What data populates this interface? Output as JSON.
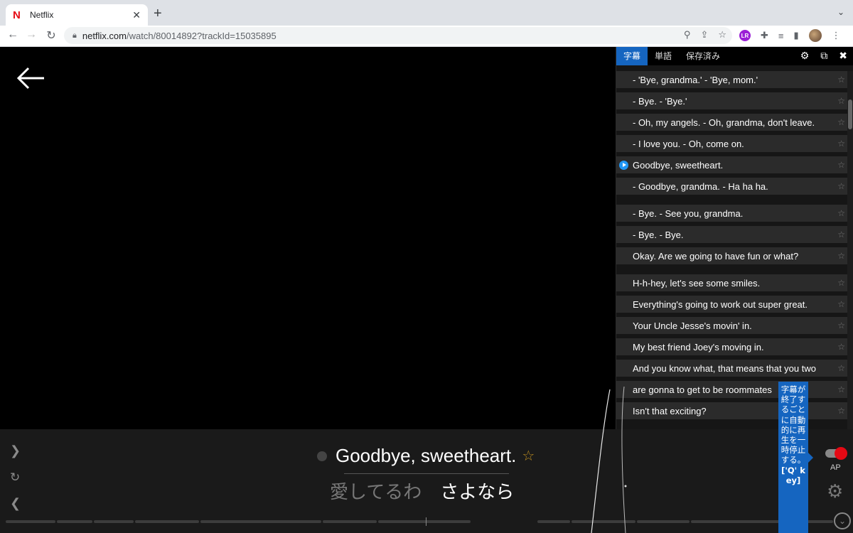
{
  "browser": {
    "tab_title": "Netflix",
    "tab_favicon": "N",
    "tab_close": "✕",
    "new_tab": "+",
    "url_host": "netflix.com",
    "url_path": "/watch/80014892?trackId=15035895",
    "extension_badge": "LR"
  },
  "panel": {
    "tabs": [
      "字幕",
      "単語",
      "保存済み"
    ],
    "active_tab": "字幕",
    "subtitles": [
      {
        "text": "- 'Bye, grandma.' - 'Bye, mom.'",
        "playing": false
      },
      {
        "text": "- Bye. - 'Bye.'",
        "playing": false
      },
      {
        "text": "- Oh, my angels. - Oh, grandma, don't leave.",
        "playing": false
      },
      {
        "text": "- I love you. - Oh, come on.",
        "playing": false
      },
      {
        "text": "Goodbye, sweetheart.",
        "playing": true
      },
      {
        "text": "- Goodbye, grandma. - Ha ha ha.",
        "playing": false
      },
      {
        "text": "- Bye. - See you, grandma.",
        "playing": false
      },
      {
        "text": "- Bye. - Bye.",
        "playing": false
      },
      {
        "text": "Okay. Are we going to have fun or what?",
        "playing": false
      },
      {
        "text": "H-h-hey, let's see some smiles.",
        "playing": false
      },
      {
        "text": "Everything's going to work out super great.",
        "playing": false
      },
      {
        "text": "Your Uncle Jesse's movin' in.",
        "playing": false
      },
      {
        "text": "My best friend Joey's moving in.",
        "playing": false
      },
      {
        "text": "And you know what, that means that you two",
        "playing": false
      },
      {
        "text": "are gonna to get to be roommates",
        "playing": false
      },
      {
        "text": "Isn't that exciting?",
        "playing": false
      }
    ],
    "star_symbol": "☆"
  },
  "player": {
    "current_subtitle": "Goodbye, sweetheart.",
    "translation_word1": "愛してるわ",
    "translation_word2": "さよなら",
    "star_symbol": "☆",
    "ap_label": "AP",
    "tooltip_text": "字幕が終了するごとに自動的に再生を一時停止する。",
    "tooltip_key": "['Q' key]"
  },
  "colors": {
    "accent_blue": "#1565c0",
    "netflix_red": "#e50914",
    "star_gold": "#b88a20"
  },
  "icons": [
    "back-arrow-icon",
    "skip-forward-icon",
    "replay-icon",
    "skip-back-icon",
    "settings-gear-icon",
    "popout-icon",
    "close-icon",
    "chevron-down-icon"
  ]
}
